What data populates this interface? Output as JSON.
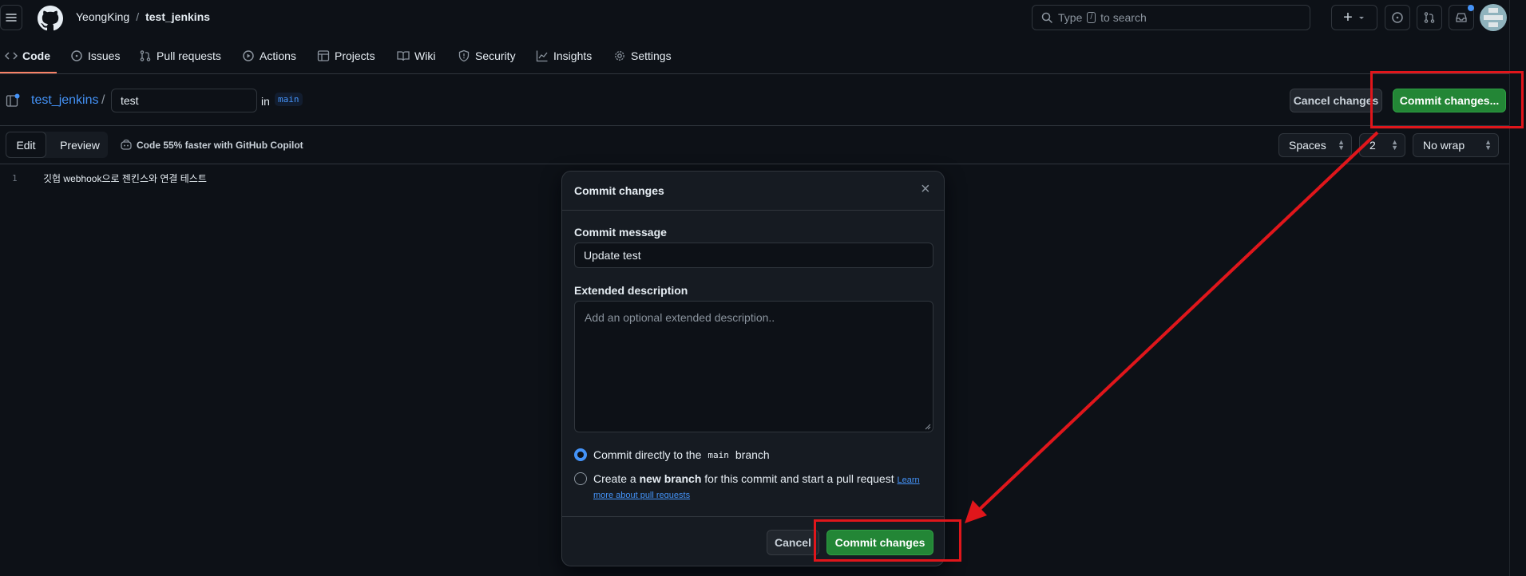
{
  "header": {
    "owner": "YeongKing",
    "separator": "/",
    "repo": "test_jenkins",
    "search_prefix": "Type",
    "search_key": "/",
    "search_suffix": "to search",
    "plus_label": "+"
  },
  "nav": {
    "tabs": [
      {
        "label": "Code"
      },
      {
        "label": "Issues"
      },
      {
        "label": "Pull requests"
      },
      {
        "label": "Actions"
      },
      {
        "label": "Projects"
      },
      {
        "label": "Wiki"
      },
      {
        "label": "Security"
      },
      {
        "label": "Insights"
      },
      {
        "label": "Settings"
      }
    ]
  },
  "editor_bar": {
    "repo_link": "test_jenkins",
    "slash": "/",
    "filename": "test",
    "in_label": "in",
    "branch": "main",
    "cancel_label": "Cancel changes",
    "commit_label": "Commit changes..."
  },
  "toolbar": {
    "edit_tab": "Edit",
    "preview_tab": "Preview",
    "copilot_text": "Code 55% faster with GitHub Copilot",
    "indent_mode": "Spaces",
    "indent_size": "2",
    "wrap_mode": "No wrap"
  },
  "code": {
    "lines": [
      {
        "num": "1",
        "text": "깃헙 webhook으로 젠킨스와 연결 테스트"
      }
    ]
  },
  "dialog": {
    "title": "Commit changes",
    "close_glyph": "×",
    "message_label": "Commit message",
    "message_value": "Update test",
    "description_label": "Extended description",
    "description_placeholder": "Add an optional extended description..",
    "option1_prefix": "Commit directly to the",
    "option1_branch": "main",
    "option1_suffix": "branch",
    "option2_prefix": "Create a",
    "option2_bold": "new branch",
    "option2_suffix": "for this commit and start a pull request",
    "option2_link_part1": "Learn",
    "option2_link_part2": "more about pull requests",
    "cancel_label": "Cancel",
    "commit_label": "Commit changes"
  },
  "colors": {
    "background": "#0d1117",
    "accent_green": "#238636",
    "link_blue": "#4493f8",
    "annotation_red": "#e0161b"
  }
}
